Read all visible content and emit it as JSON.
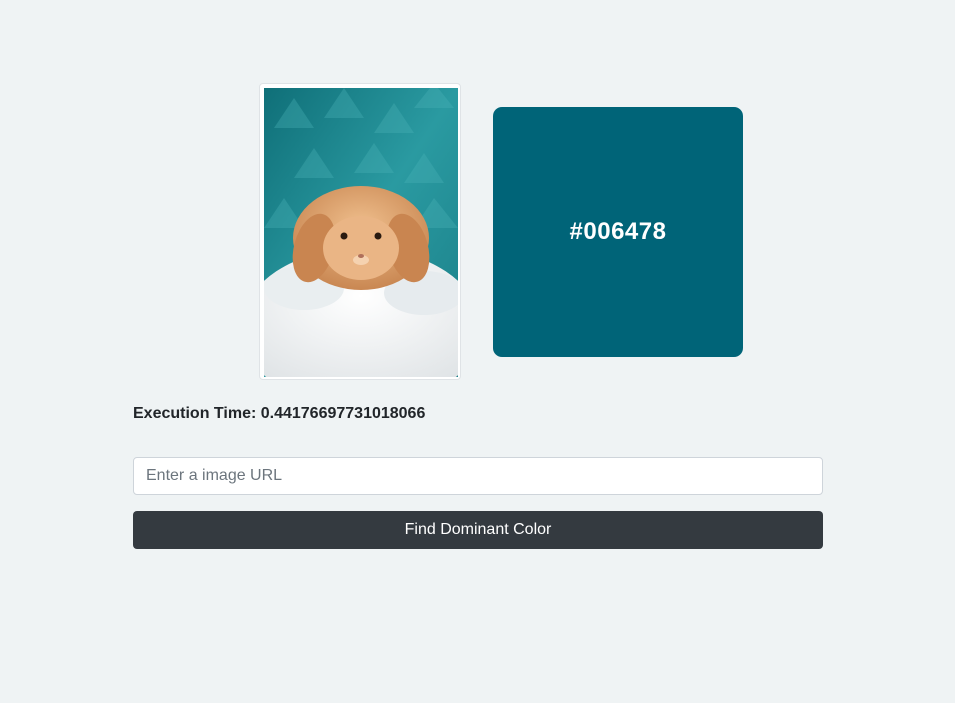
{
  "preview": {
    "image_name": "bunny-photo",
    "colors": {
      "background": "#1f8f95",
      "fur": "#d9a070",
      "fluff": "#f2f3f4"
    }
  },
  "result": {
    "hex_label": "#006478",
    "swatch_color": "#006478"
  },
  "execution": {
    "label": "Execution Time: 0.44176697731018066"
  },
  "form": {
    "url_placeholder": "Enter a image URL",
    "url_value": "",
    "submit_label": "Find Dominant Color"
  }
}
